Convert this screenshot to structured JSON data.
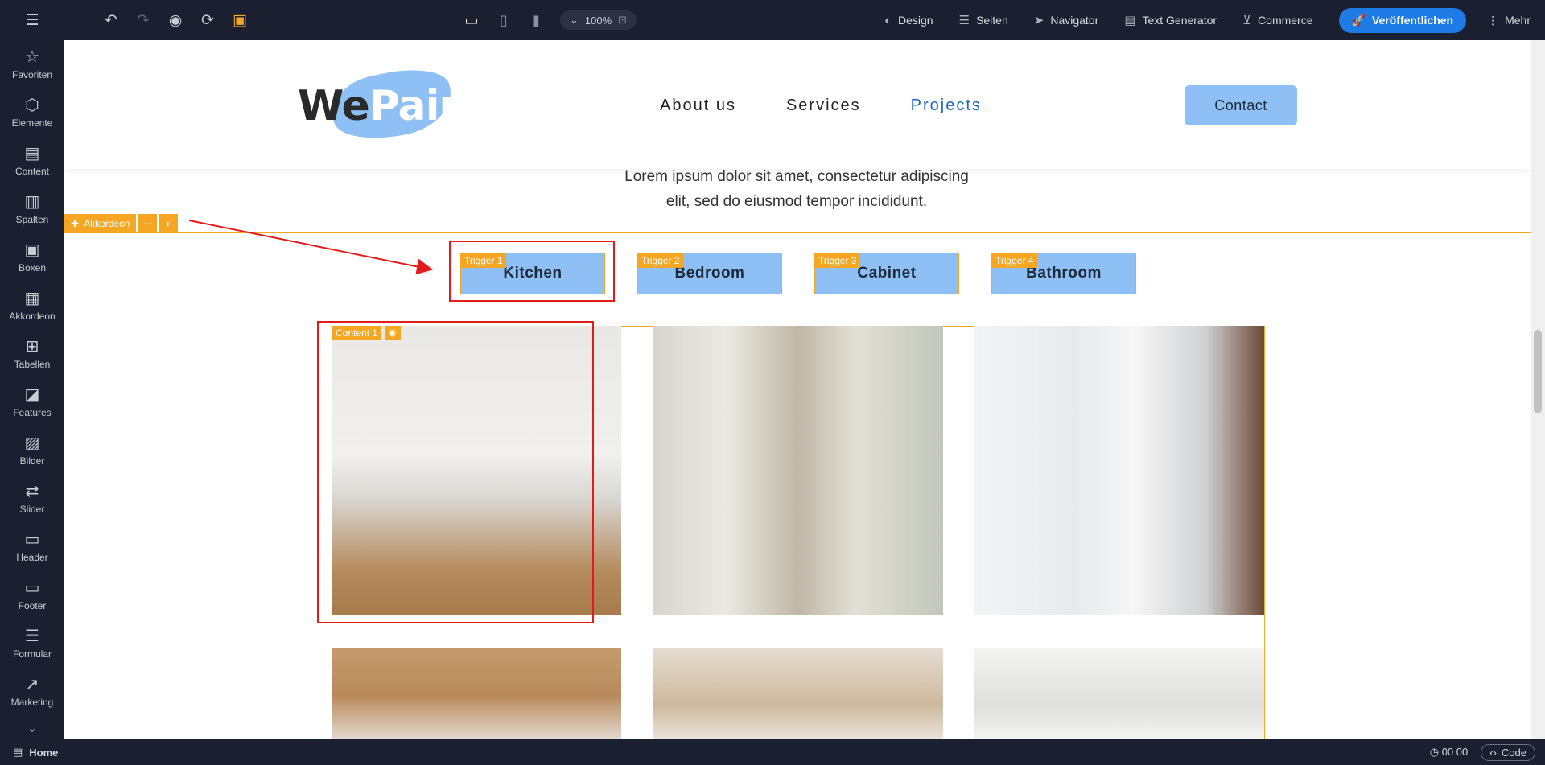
{
  "topbar": {
    "zoom": "100%",
    "links": [
      {
        "label": "Design",
        "icon": "palette-icon"
      },
      {
        "label": "Seiten",
        "icon": "list-icon"
      },
      {
        "label": "Navigator",
        "icon": "navigation-icon"
      },
      {
        "label": "Text Generator",
        "icon": "document-icon"
      },
      {
        "label": "Commerce",
        "icon": "cart-icon"
      }
    ],
    "publish_label": "Veröffentlichen",
    "more_label": "Mehr"
  },
  "sidebar": {
    "items": [
      {
        "label": "Favoriten",
        "icon": "star-icon",
        "glyph": "☆"
      },
      {
        "label": "Elemente",
        "icon": "cube-icon",
        "glyph": "⬡"
      },
      {
        "label": "Content",
        "icon": "document-icon",
        "glyph": "▤"
      },
      {
        "label": "Spalten",
        "icon": "columns-icon",
        "glyph": "▥"
      },
      {
        "label": "Boxen",
        "icon": "box-icon",
        "glyph": "▣"
      },
      {
        "label": "Akkordeon",
        "icon": "accordion-icon",
        "glyph": "▦"
      },
      {
        "label": "Tabellen",
        "icon": "table-icon",
        "glyph": "⊞"
      },
      {
        "label": "Features",
        "icon": "features-icon",
        "glyph": "◪"
      },
      {
        "label": "Bilder",
        "icon": "image-icon",
        "glyph": "▨"
      },
      {
        "label": "Slider",
        "icon": "slider-icon",
        "glyph": "⇄"
      },
      {
        "label": "Header",
        "icon": "header-icon",
        "glyph": "▭"
      },
      {
        "label": "Footer",
        "icon": "footer-icon",
        "glyph": "▭"
      },
      {
        "label": "Formular",
        "icon": "form-icon",
        "glyph": "☰"
      },
      {
        "label": "Marketing",
        "icon": "chart-icon",
        "glyph": "↗"
      }
    ]
  },
  "site": {
    "logo_we": "We",
    "logo_paint": "Paint",
    "nav": [
      "About us",
      "Services",
      "Projects"
    ],
    "nav_active": "Projects",
    "contact_label": "Contact",
    "intro_line1": "Lorem ipsum dolor sit amet, consectetur adipiscing",
    "intro_line2": "elit, sed do eiusmod tempor incididunt."
  },
  "accordion": {
    "tag_label": "Akkordeon",
    "triggers": [
      {
        "tag": "Trigger 1",
        "label": "Kitchen"
      },
      {
        "tag": "Trigger 2",
        "label": "Bedroom"
      },
      {
        "tag": "Trigger 3",
        "label": "Cabinet"
      },
      {
        "tag": "Trigger 4",
        "label": "Bathroom"
      }
    ],
    "content_tag": "Content 1"
  },
  "bottombar": {
    "page_label": "Home",
    "timer": "00 00",
    "code_label": "Code"
  },
  "colors": {
    "chrome": "#1b2030",
    "accent_orange": "#f5a623",
    "publish_blue": "#1e7be6",
    "site_blue": "#8ec0f5",
    "annotation_red": "#e21b1b"
  }
}
